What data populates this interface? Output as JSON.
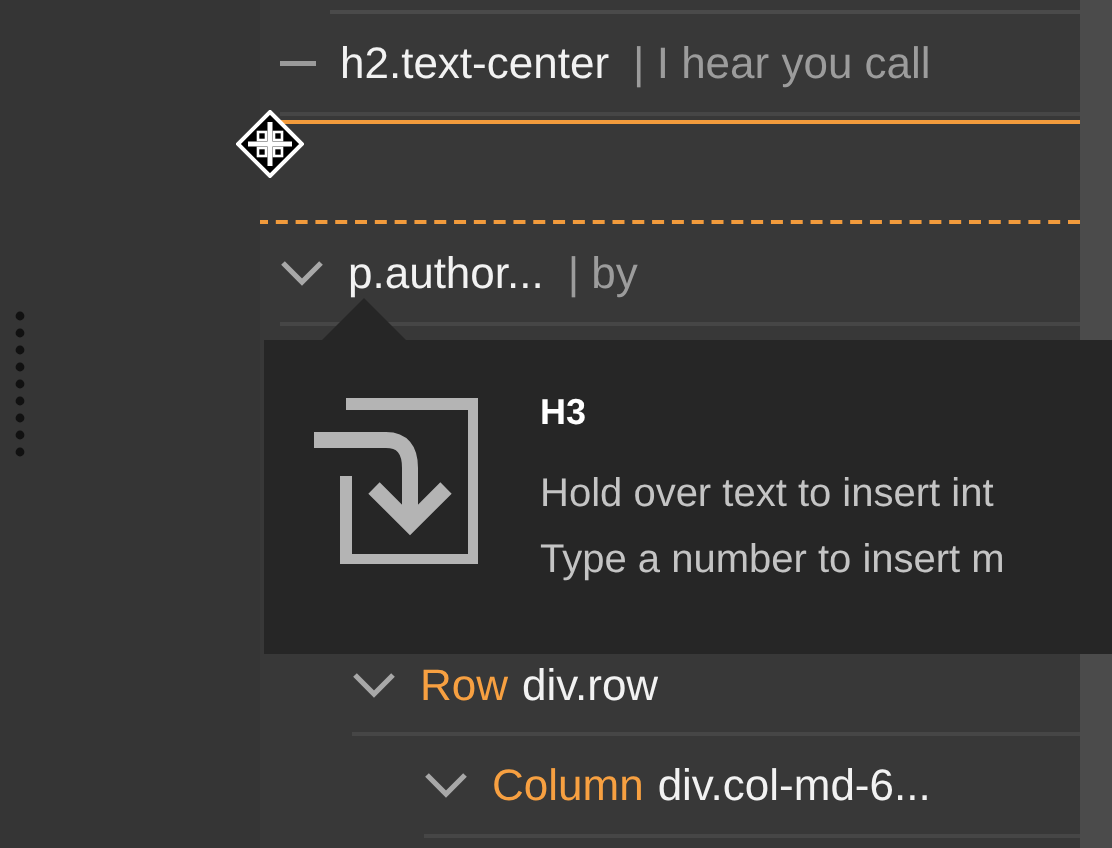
{
  "tree": [
    {
      "kind": "leaf",
      "tag": "h2.text-center",
      "note": "| I hear you call"
    },
    {
      "kind": "drop-zone"
    },
    {
      "kind": "node",
      "tag": "p.author...",
      "note": "| by",
      "expanded": true
    }
  ],
  "tooltip": {
    "title": "H3",
    "lines": [
      "Hold over text to insert int",
      "Type a number to insert m"
    ]
  },
  "tree_below": [
    {
      "kind": "node",
      "label": "Row",
      "tag": "div.row",
      "expanded": true,
      "children": [
        {
          "kind": "node",
          "label": "Column",
          "tag": "div.col-md-6...",
          "expanded": true
        }
      ]
    }
  ]
}
